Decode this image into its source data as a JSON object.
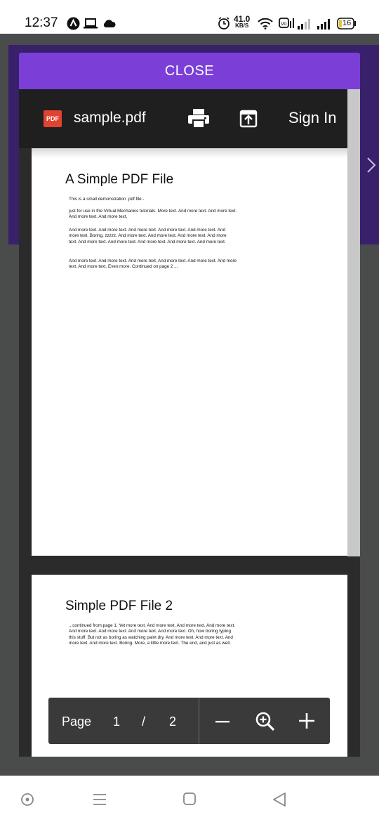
{
  "status_bar": {
    "time": "12:37",
    "speed_value": "41.0",
    "speed_unit": "KB/S",
    "battery": "16",
    "icons": [
      "accessibility-a-icon",
      "laptop-icon",
      "cloud-icon",
      "alarm-icon",
      "wifi-icon",
      "volte-icon",
      "signal-1-icon",
      "signal-2-icon",
      "battery-icon"
    ]
  },
  "close_button": {
    "label": "CLOSE"
  },
  "viewer": {
    "file_badge": "PDF",
    "filename": "sample.pdf",
    "sign_in": "Sign In",
    "icons": [
      "print-icon",
      "open-external-icon"
    ]
  },
  "pages": [
    {
      "title": "A Simple PDF File",
      "paragraphs": [
        "This is a small demonstration .pdf file -",
        "just for use in the Virtual Mechanics tutorials. More text. And more text. And more text. And more text. And more text.",
        "And more text. And more text. And more text. And more text. And more text. And more text. Boring, zzzzz. And more text. And more text. And more text. And more text. And more text. And more text. And more text. And more text. And more text.",
        "And more text. And more text. And more text. And more text. And more text. And more text. And more text. Even more. Continued on page 2 ..."
      ]
    },
    {
      "title": "Simple PDF File 2",
      "paragraphs": [
        "...continued from page 1. Yet more text. And more text. And more text. And more text. And more text. And more text. And more text. And more text. Oh, how boring typing this stuff. But not as boring as watching paint dry. And more text. And more text. And more text. And more text. Boring.  More, a little more text. The end, and just as well."
      ]
    }
  ],
  "page_control": {
    "label": "Page",
    "current": "1",
    "separator": "/",
    "total": "2",
    "icons": [
      "zoom-out-icon",
      "zoom-icon",
      "zoom-in-icon"
    ]
  },
  "nav_bar": {
    "icons": [
      "assistant-dot-icon",
      "recents-icon",
      "home-icon",
      "back-icon"
    ]
  },
  "colors": {
    "accent": "#7b3fd8",
    "background_app": "#38206b",
    "toolbar": "#1f1f1f",
    "pdf_badge": "#e0432f"
  }
}
